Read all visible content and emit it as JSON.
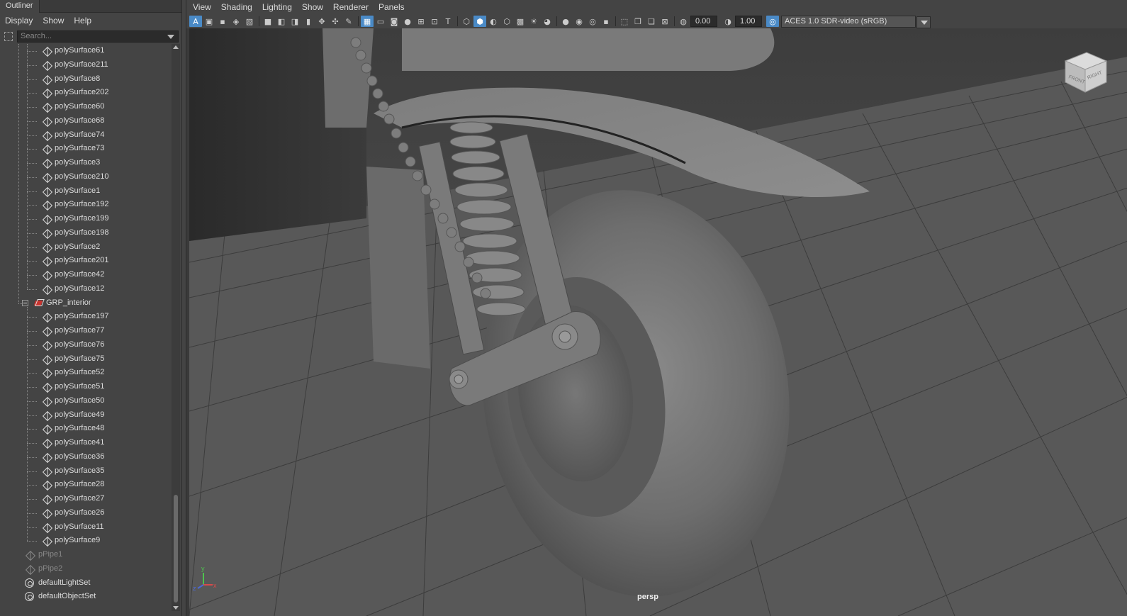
{
  "outliner": {
    "tab_label": "Outliner",
    "menu": [
      "Display",
      "Show",
      "Help"
    ],
    "search_placeholder": "Search...",
    "items_top": [
      "polySurface61",
      "polySurface211",
      "polySurface8",
      "polySurface202",
      "polySurface60",
      "polySurface68",
      "polySurface74",
      "polySurface73",
      "polySurface3",
      "polySurface210",
      "polySurface1",
      "polySurface192",
      "polySurface199",
      "polySurface198",
      "polySurface2",
      "polySurface201",
      "polySurface42",
      "polySurface12"
    ],
    "group_label": "GRP_interior",
    "group_items": [
      "polySurface197",
      "polySurface77",
      "polySurface76",
      "polySurface75",
      "polySurface52",
      "polySurface51",
      "polySurface50",
      "polySurface49",
      "polySurface48",
      "polySurface41",
      "polySurface36",
      "polySurface35",
      "polySurface28",
      "polySurface27",
      "polySurface26",
      "polySurface11",
      "polySurface9"
    ],
    "root_items": [
      {
        "label": "pPipe1",
        "type": "mesh",
        "dim": true
      },
      {
        "label": "pPipe2",
        "type": "mesh",
        "dim": true
      },
      {
        "label": "defaultLightSet",
        "type": "set",
        "dim": false
      },
      {
        "label": "defaultObjectSet",
        "type": "set",
        "dim": false
      }
    ]
  },
  "viewport": {
    "menu": [
      "View",
      "Shading",
      "Lighting",
      "Show",
      "Renderer",
      "Panels"
    ],
    "exposure_value": "0.00",
    "gamma_value": "1.00",
    "color_space": "ACES 1.0 SDR-video (sRGB)",
    "camera_label": "persp",
    "view_cube_labels": [
      "FRONT",
      "RIGHT"
    ],
    "accent_color": "#4a8ac6"
  }
}
